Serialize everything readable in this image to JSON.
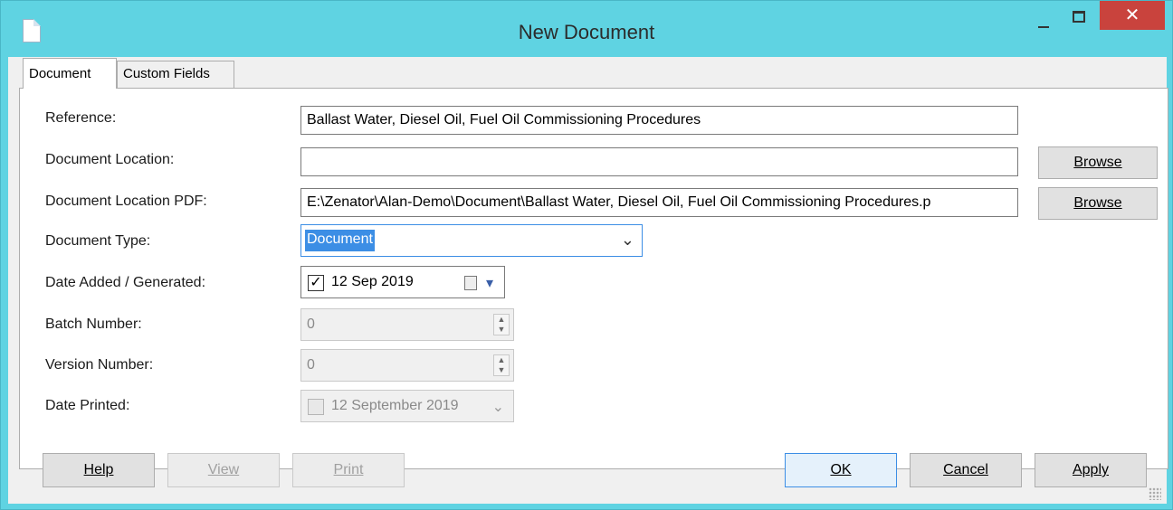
{
  "window": {
    "title": "New Document",
    "close_glyph": "✕"
  },
  "tabs": [
    {
      "label": "Document",
      "selected": true
    },
    {
      "label": "Custom Fields",
      "selected": false
    }
  ],
  "form": {
    "reference": {
      "label": "Reference:",
      "value": "Ballast Water, Diesel Oil, Fuel Oil Commissioning Procedures"
    },
    "document_location": {
      "label": "Document Location:",
      "value": "",
      "browse_label": "Browse"
    },
    "document_location_pdf": {
      "label": "Document Location PDF:",
      "value": "E:\\Zenator\\Alan-Demo\\Document\\Ballast Water, Diesel Oil, Fuel Oil Commissioning Procedures.p",
      "browse_label": "Browse"
    },
    "document_type": {
      "label": "Document Type:",
      "value": "Document"
    },
    "date_added": {
      "label": "Date Added / Generated:",
      "value": "12 Sep 2019",
      "checked": true
    },
    "batch_number": {
      "label": "Batch Number:",
      "value": "0"
    },
    "version_number": {
      "label": "Version Number:",
      "value": "0"
    },
    "date_printed": {
      "label": "Date Printed:",
      "value": "12 September 2019",
      "checked": false
    }
  },
  "buttons": {
    "help": "Help",
    "view": "View",
    "print": "Print",
    "ok": "OK",
    "cancel": "Cancel",
    "apply": "Apply"
  },
  "colors": {
    "titlebar": "#5fd3e2",
    "close_button": "#c9433d",
    "selection": "#3c8ee5"
  }
}
